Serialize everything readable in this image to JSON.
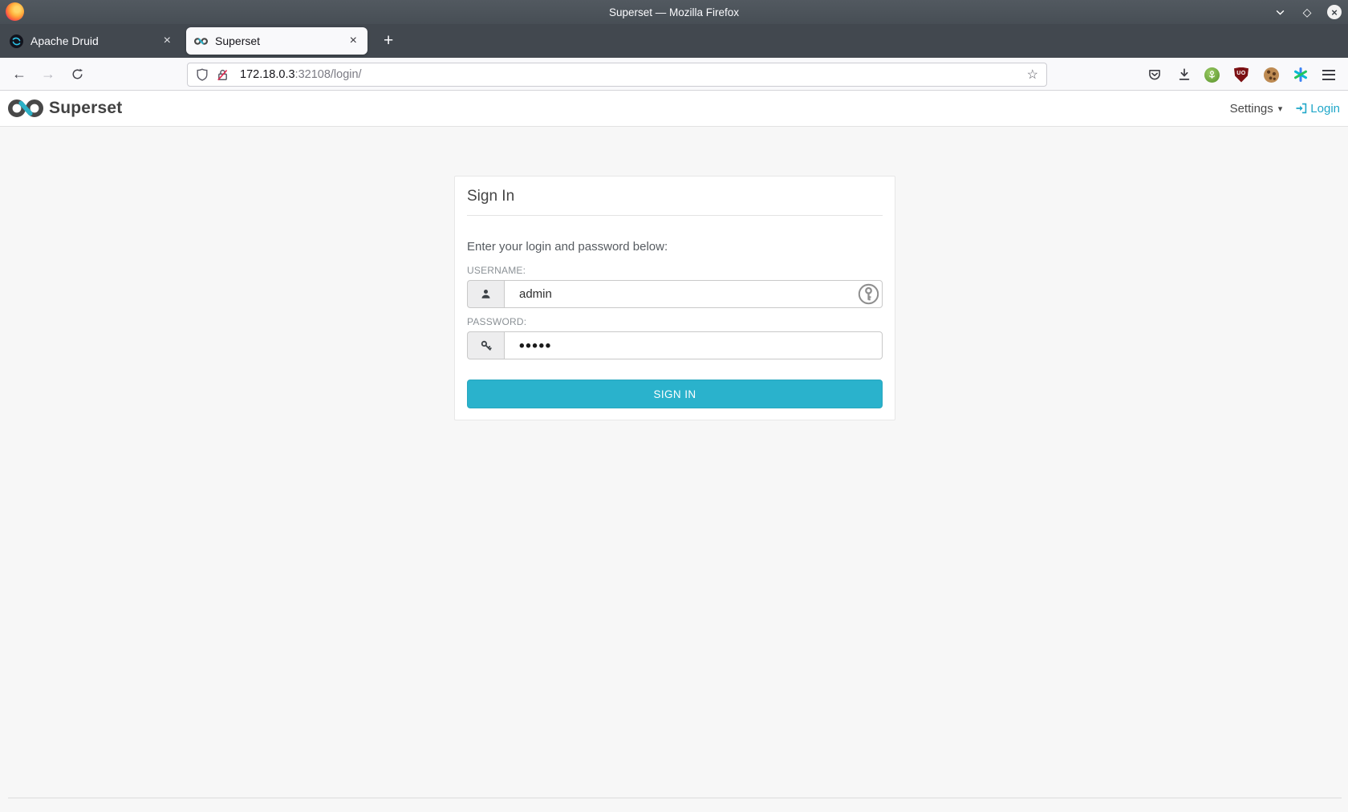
{
  "titlebar": {
    "title": "Superset — Mozilla Firefox"
  },
  "icons": {
    "close_glyph": "×",
    "plus_glyph": "+",
    "back_glyph": "←",
    "forward_glyph": "→",
    "star_glyph": "☆",
    "caret_down_glyph": "▾",
    "maximize_glyph": "◇",
    "ublock_badge": "UO"
  },
  "tabs": [
    {
      "label": "Apache Druid"
    },
    {
      "label": "Superset"
    }
  ],
  "navbar": {
    "url_host": "172.18.0.3",
    "url_path": ":32108/login/"
  },
  "site_header": {
    "brand": "Superset",
    "settings": "Settings",
    "login": "Login"
  },
  "login": {
    "title": "Sign In",
    "instructions": "Enter your login and password below:",
    "username_label": "USERNAME:",
    "username_value": "admin",
    "password_label": "PASSWORD:",
    "password_value": "•••••",
    "submit": "SIGN IN"
  },
  "colors": {
    "accent": "#20a7c9",
    "signin_button": "#2ab2cc",
    "ublock_red": "#7c1114",
    "titlebar_bg": "#4a5158",
    "page_bg": "#f7f7f7"
  }
}
